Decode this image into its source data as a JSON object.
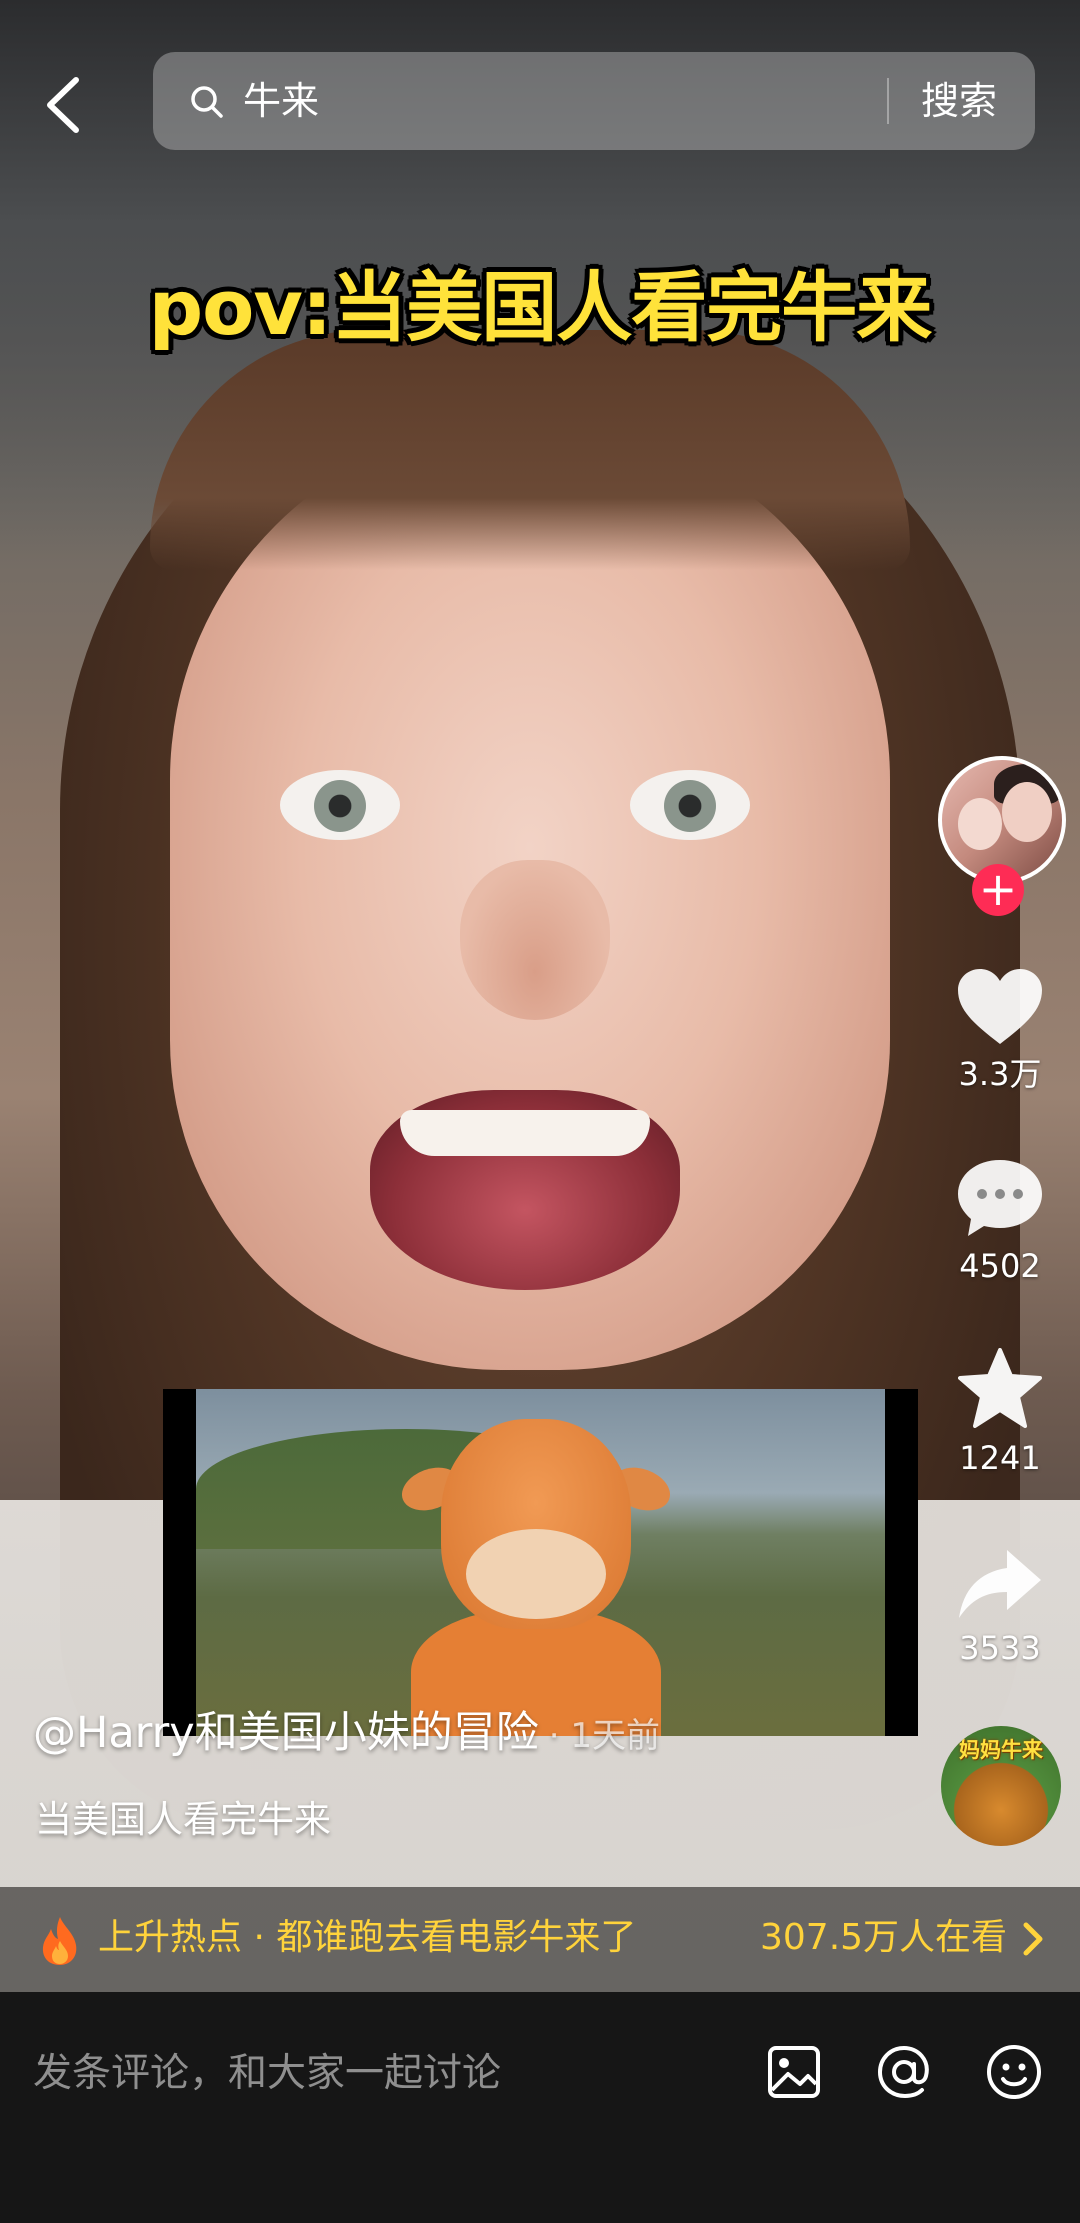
{
  "search": {
    "query": "牛来",
    "button_label": "搜索"
  },
  "video": {
    "caption": "pov:当美国人看完牛来"
  },
  "rail": {
    "likes": "3.3万",
    "comments": "4502",
    "favorites": "1241",
    "shares": "3533",
    "music_label": "妈妈牛来",
    "follow_symbol": "+"
  },
  "author": {
    "handle": "@Harry和美国小妹的冒险",
    "time": "· 1天前"
  },
  "description": "当美国人看完牛来",
  "hot": {
    "label": "上升热点 · 都谁跑去看电影牛来了",
    "viewers": "307.5万人在看"
  },
  "comment_bar": {
    "placeholder": "发条评论，和大家一起讨论"
  },
  "icons": {
    "back": "chevron-left-icon",
    "search": "search-icon",
    "like": "heart-icon",
    "comment": "speech-bubble-icon",
    "favorite": "star-icon",
    "share": "share-arrow-icon",
    "hot": "flame-icon",
    "image": "image-icon",
    "mention": "at-icon",
    "emoji": "emoji-icon"
  },
  "colors": {
    "accent_yellow": "#ffd33b",
    "caption_yellow": "#ffe23a",
    "follow_red": "#fe2c55",
    "comment_bar_bg": "#161616"
  }
}
